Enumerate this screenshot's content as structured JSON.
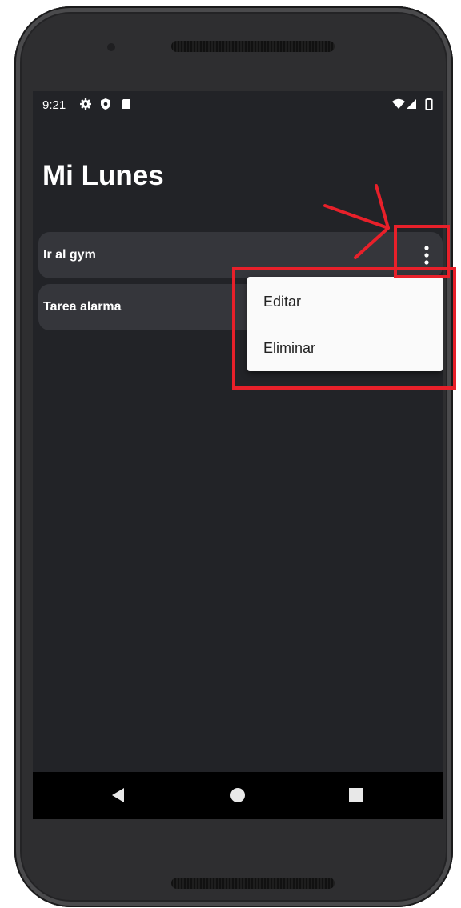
{
  "status_bar": {
    "time": "9:21",
    "left_icons": [
      "settings-gear-icon",
      "shield-icon",
      "sd-card-icon"
    ],
    "right_icons": [
      "wifi-icon",
      "signal-icon",
      "battery-icon"
    ]
  },
  "app": {
    "title": "Mi Lunes"
  },
  "tasks": [
    {
      "label": "Ir al gym"
    },
    {
      "label": "Tarea alarma"
    }
  ],
  "popup_menu": {
    "items": [
      {
        "label": "Editar"
      },
      {
        "label": "Eliminar"
      }
    ]
  },
  "navigation_bar": {
    "buttons": [
      "back-icon",
      "home-icon",
      "recents-icon"
    ]
  },
  "annotation": {
    "color": "#e8202a",
    "shapes": [
      "arrow",
      "rectangle",
      "rectangle"
    ]
  }
}
